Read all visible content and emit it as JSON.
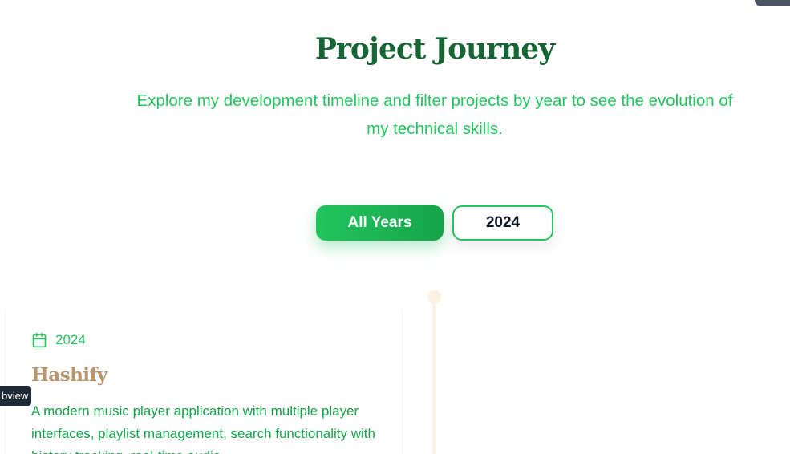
{
  "header": {
    "title": "Project Journey",
    "subtitle": "Explore my development timeline and filter projects by year to see the evolution of my technical skills."
  },
  "filters": {
    "all_label": "All Years",
    "year_label": "2024",
    "active": "All Years"
  },
  "projects": [
    {
      "year": "2024",
      "title": "Hashify",
      "description": "A modern music player application with multiple player interfaces, playlist management, search functionality with history tracking, real-time audio"
    }
  ],
  "tooltip": {
    "text": "bview"
  },
  "colors": {
    "title": "#166534",
    "accent": "#22c55e",
    "project_title": "#b9936a",
    "timeline": "#fdf1e2"
  },
  "icons": {
    "calendar": "calendar-icon"
  }
}
